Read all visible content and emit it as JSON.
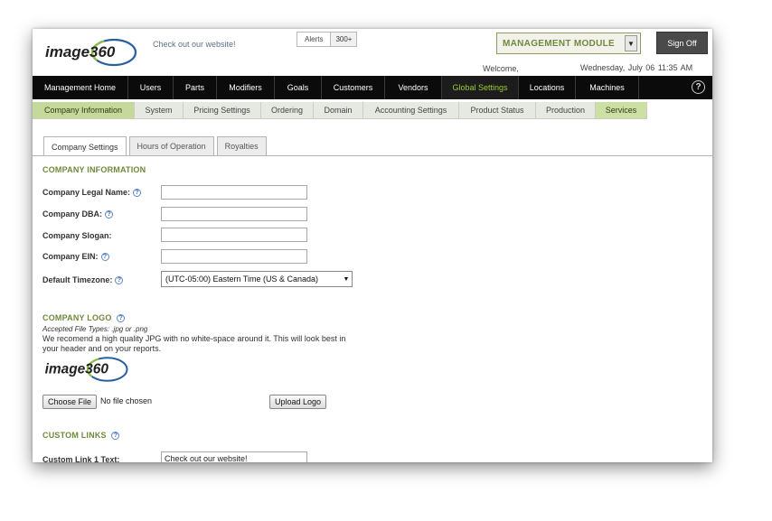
{
  "header": {
    "logo_text": "image360",
    "site_link": "Check out our website!",
    "alerts_label": "Alerts",
    "alerts_count": "300+",
    "module": "MANAGEMENT MODULE",
    "sign_off": "Sign Off",
    "welcome": "Welcome,",
    "datetime": "Wednesday, July 06   11:35 AM"
  },
  "main_nav": [
    "Management Home",
    "Users",
    "Parts",
    "Modifiers",
    "Goals",
    "Customers",
    "Vendors",
    "Global Settings",
    "Locations",
    "Machines"
  ],
  "main_nav_active": "Global Settings",
  "sub_nav": [
    "Company Information",
    "System",
    "Pricing Settings",
    "Ordering",
    "Domain",
    "Accounting Settings",
    "Product Status",
    "Production",
    "Services"
  ],
  "sub_nav_active": "Company Information",
  "tabs": [
    "Company Settings",
    "Hours of Operation",
    "Royalties"
  ],
  "tabs_active": "Company Settings",
  "company_info": {
    "title": "COMPANY INFORMATION",
    "legal_name_label": "Company Legal Name:",
    "legal_name_value": "",
    "dba_label": "Company DBA:",
    "dba_value": "",
    "slogan_label": "Company Slogan:",
    "slogan_value": "",
    "ein_label": "Company EIN:",
    "ein_value": "",
    "timezone_label": "Default Timezone:",
    "timezone_value": "(UTC-05:00) Eastern Time (US & Canada)"
  },
  "company_logo": {
    "title": "COMPANY LOGO",
    "accepted_types": "Accepted File Types: .jpg or .png",
    "recommend": "We recomend a high quality JPG with no white-space around it. This will look best in your header and on your reports.",
    "choose_file": "Choose File",
    "no_file": "No file chosen",
    "upload": "Upload Logo"
  },
  "custom_links": {
    "title": "CUSTOM LINKS",
    "link1_label": "Custom Link 1 Text:",
    "link1_value": "Check out our website!"
  },
  "colors": {
    "nav_bg": "#0b0b0b",
    "accent_green": "#6f8a3c",
    "active_green": "#9acd32",
    "subnav_active": "#c5d99a",
    "logo_blue": "#2a5f9e"
  }
}
